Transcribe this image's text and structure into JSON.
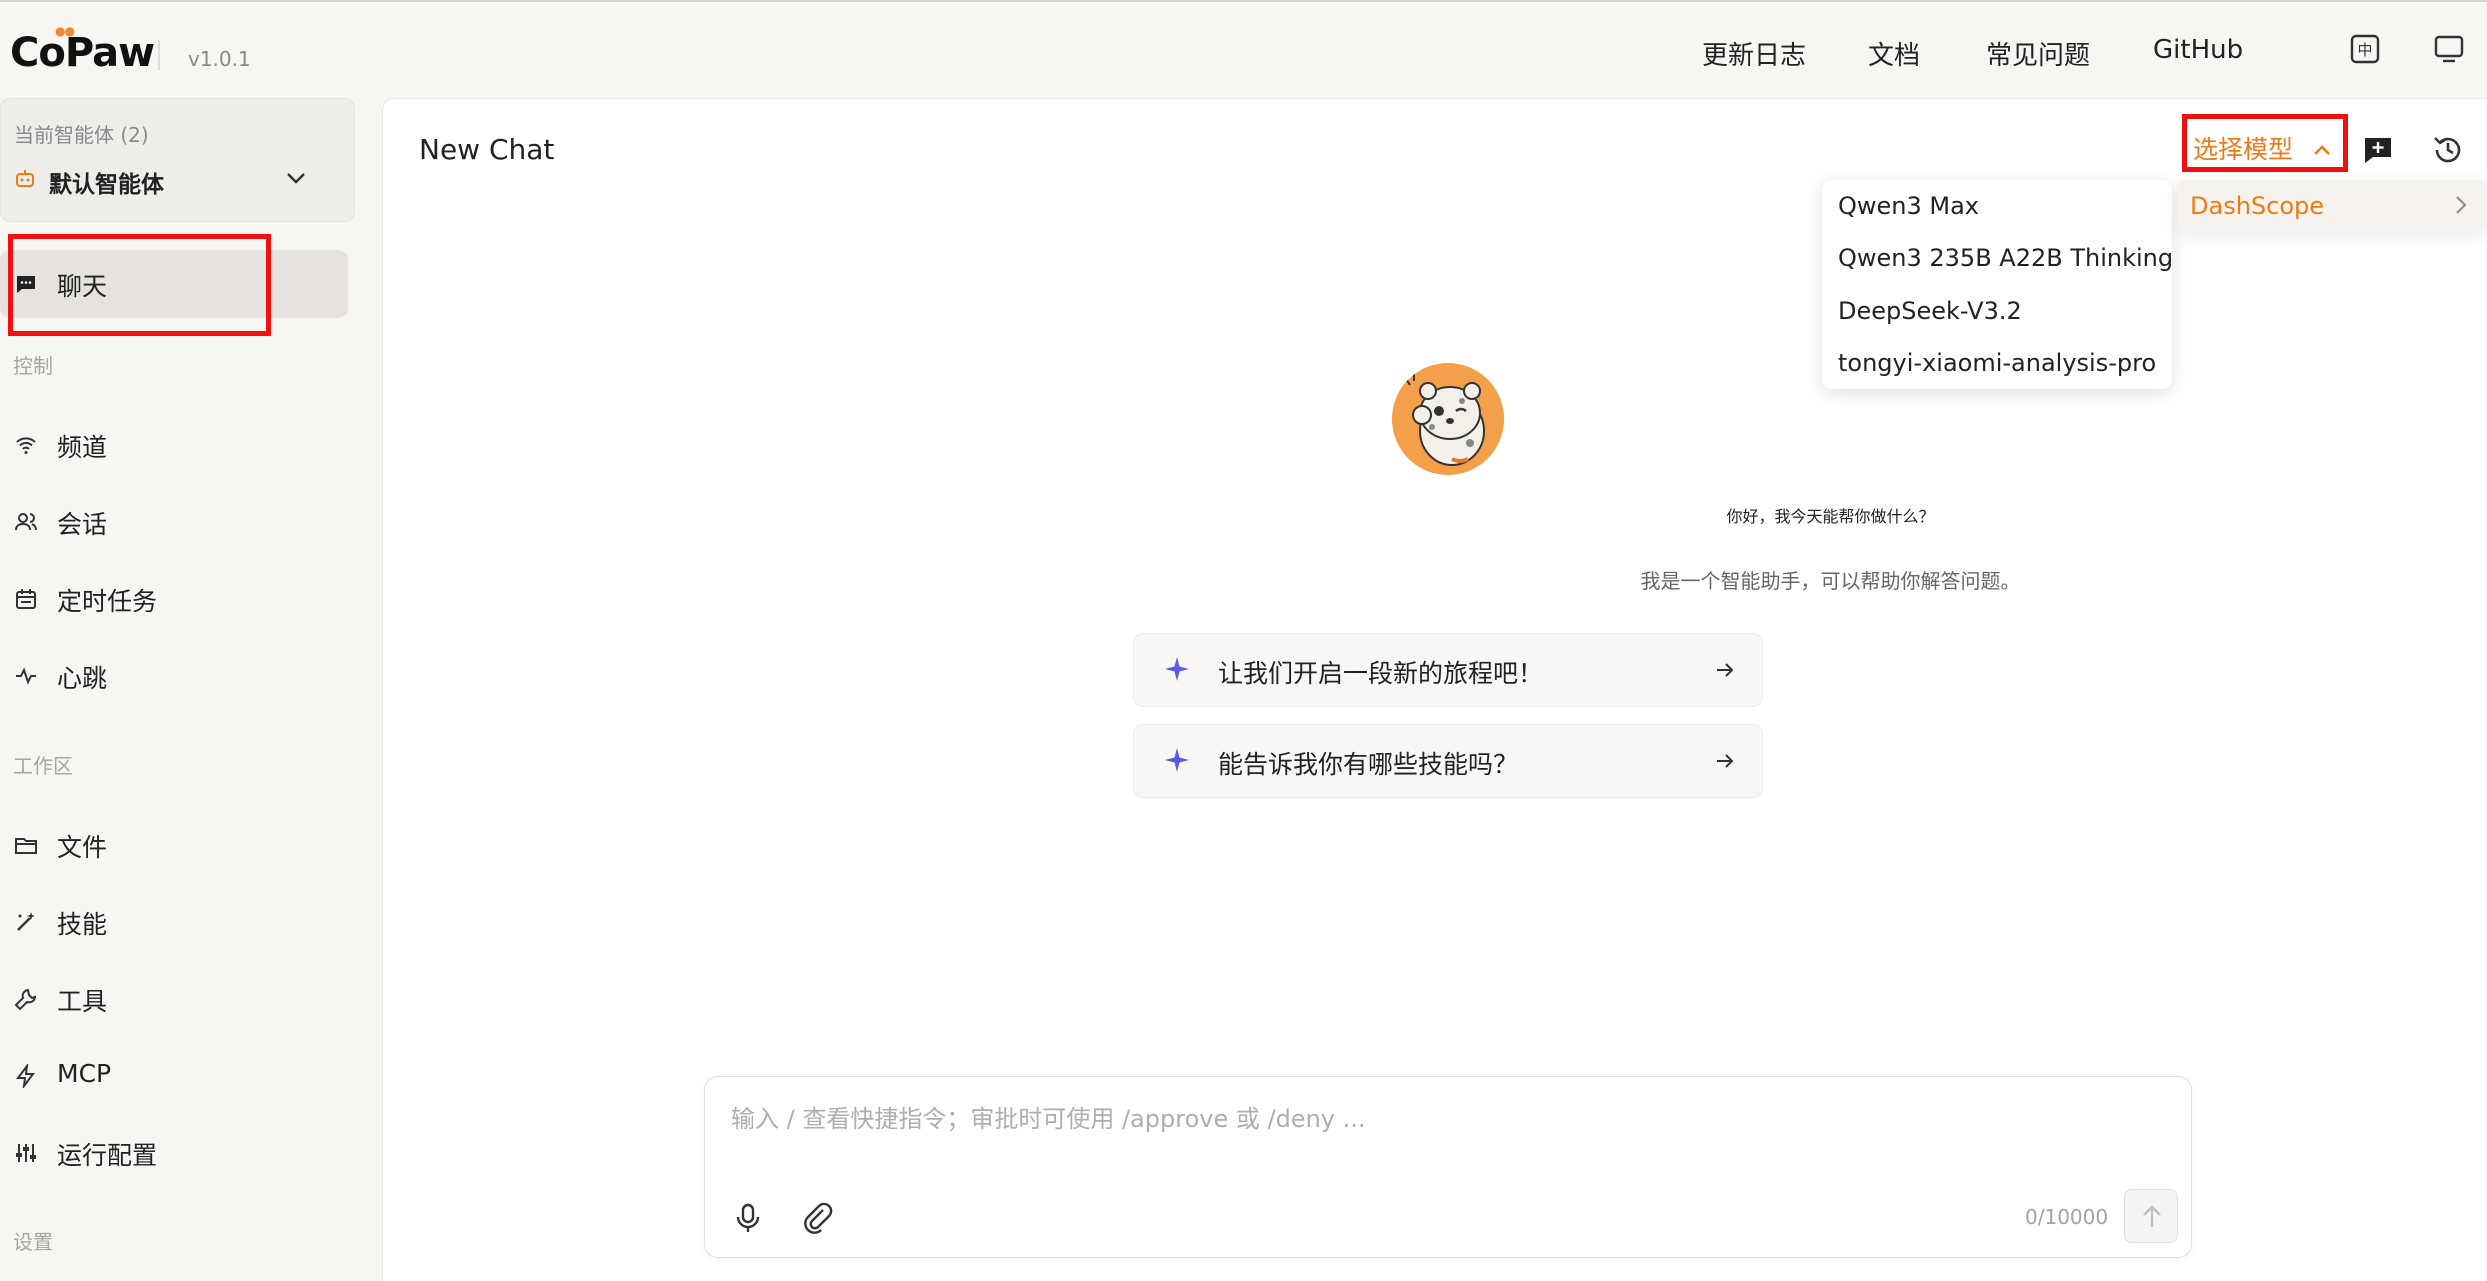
{
  "app": {
    "logo": "CoPaw",
    "version": "v1.0.1"
  },
  "topnav": {
    "links": [
      "更新日志",
      "文档",
      "常见问题",
      "GitHub"
    ],
    "lang_icon": "translate-icon",
    "theme_icon": "monitor-icon"
  },
  "sidebar": {
    "agent_label": "当前智能体 (2)",
    "agent_name": "默认智能体",
    "chat_item": "聊天",
    "section_control": "控制",
    "control_items": [
      "频道",
      "会话",
      "定时任务",
      "心跳"
    ],
    "section_workspace": "工作区",
    "workspace_items": [
      "文件",
      "技能",
      "工具",
      "MCP",
      "运行配置"
    ],
    "section_settings": "设置"
  },
  "main": {
    "title": "New Chat",
    "model_select_label": "选择模型",
    "model_dropdown": {
      "provider": "DashScope",
      "models": [
        "Qwen3 Max",
        "Qwen3 235B A22B Thinking",
        "DeepSeek-V3.2",
        "tongyi-xiaomi-analysis-pro"
      ]
    },
    "welcome": {
      "greeting": "你好，我今天能帮你做什么？",
      "subtitle": "我是一个智能助手，可以帮助你解答问题。",
      "prompts": [
        "让我们开启一段新的旅程吧！",
        "能告诉我你有哪些技能吗？"
      ]
    },
    "input": {
      "placeholder": "输入 / 查看快捷指令；审批时可使用 /approve 或 /deny ...",
      "counter": "0/10000"
    }
  },
  "colors": {
    "accent": "#f07a18",
    "highlight_box": "#f20f0f",
    "sparkle": "#5b5be6",
    "avatar_bg": "#f4a04a"
  }
}
